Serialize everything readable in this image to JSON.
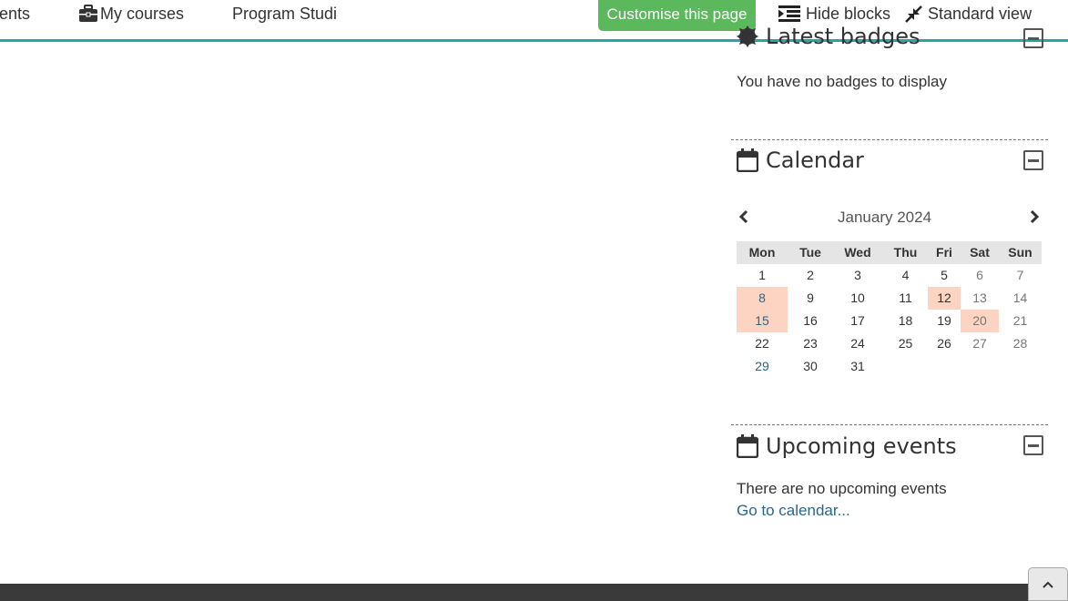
{
  "navbar": {
    "events_label": "Events",
    "my_courses_label": "My courses",
    "program_label": "Program Studi",
    "customise_label": "Customise this page",
    "hide_blocks_label": "Hide blocks",
    "standard_view_label": "Standard view"
  },
  "badges": {
    "title": "Latest badges",
    "empty_text": "You have no badges to display"
  },
  "calendar": {
    "title": "Calendar",
    "month_label": "January 2024",
    "day_headers": [
      "Mon",
      "Tue",
      "Wed",
      "Thu",
      "Fri",
      "Sat",
      "Sun"
    ],
    "weeks": [
      [
        "1",
        "2",
        "3",
        "4",
        "5",
        "6",
        "7"
      ],
      [
        "8",
        "9",
        "10",
        "11",
        "12",
        "13",
        "14"
      ],
      [
        "15",
        "16",
        "17",
        "18",
        "19",
        "20",
        "21"
      ],
      [
        "22",
        "23",
        "24",
        "25",
        "26",
        "27",
        "28"
      ],
      [
        "29",
        "30",
        "31",
        "",
        "",
        "",
        ""
      ]
    ],
    "highlighted_days": [
      "8",
      "12",
      "15",
      "20"
    ],
    "linked_days": [
      "8",
      "15",
      "29"
    ],
    "highlight_color": "#fdd3c1"
  },
  "upcoming": {
    "title": "Upcoming events",
    "empty_text": "There are no upcoming events",
    "calendar_link": "Go to calendar..."
  },
  "theme": {
    "accent": "#23a99e",
    "customise_bg": "#5cb85c",
    "link": "#2a6689",
    "footer_bg": "#3a3a3a"
  },
  "icons": {
    "my_courses": "briefcase-icon",
    "hide_blocks": "indent-icon",
    "standard_view": "compress-icon",
    "block_calendar": "calendar-icon",
    "block_badges": "certificate-icon",
    "collapse": "minus-square-icon",
    "back_to_top": "chevron-up-icon"
  }
}
